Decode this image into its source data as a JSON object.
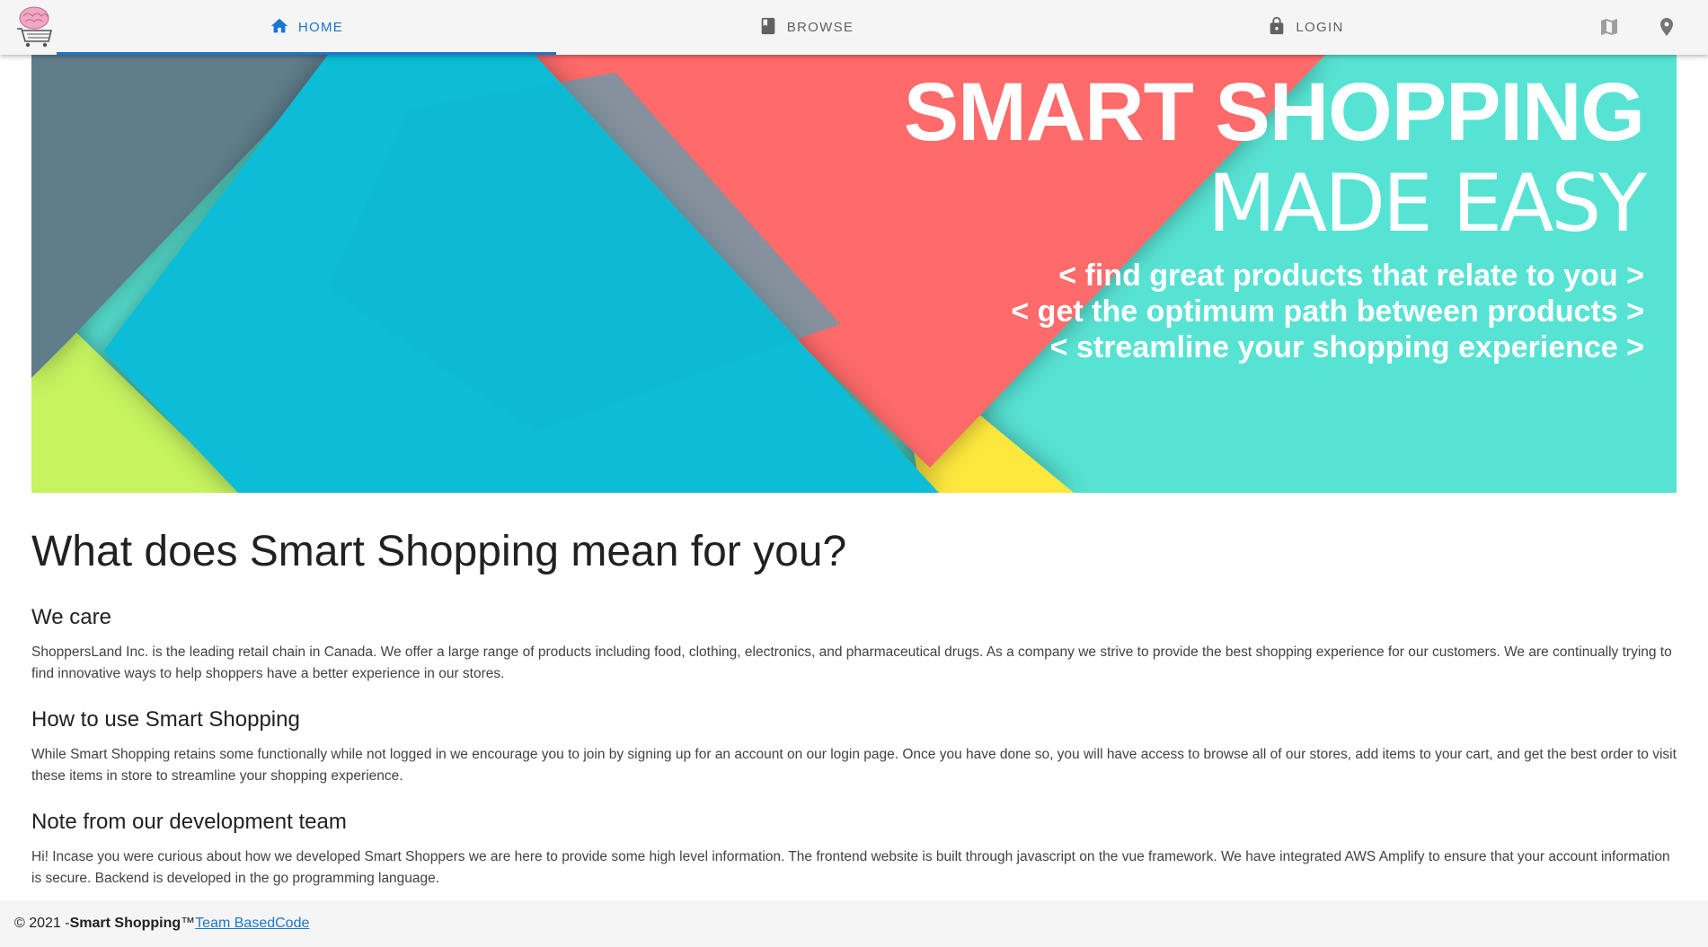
{
  "nav": {
    "tabs": [
      {
        "label": "HOME",
        "icon": "home-icon",
        "active": true
      },
      {
        "label": "BROWSE",
        "icon": "book-icon",
        "active": false
      },
      {
        "label": "LOGIN",
        "icon": "lock-icon",
        "active": false
      }
    ],
    "right_icons": [
      "map-icon",
      "map-marker-icon"
    ]
  },
  "hero": {
    "title": "SMART SHOPPING",
    "subtitle": "MADE EASY",
    "bullets": [
      "< find great products that relate to you >",
      "< get the optimum path between products >",
      "< streamline your shopping experience >"
    ]
  },
  "main": {
    "title": "What does Smart Shopping mean for you?",
    "sections": [
      {
        "heading": "We care",
        "body": "ShoppersLand Inc. is the leading retail chain in Canada. We offer a large range of products including food, clothing, electronics, and pharmaceutical drugs. As a company we strive to provide the best shopping experience for our customers. We are continually trying to find innovative ways to help shoppers have a better experience in our stores."
      },
      {
        "heading": "How to use Smart Shopping",
        "body": "While Smart Shopping retains some functionally while not logged in we encourage you to join by signing up for an account on our login page. Once you have done so, you will have access to browse all of our stores, add items to your cart, and get the best order to visit these items in store to streamline your shopping experience."
      },
      {
        "heading": "Note from our development team",
        "body": "Hi! Incase you were curious about how we developed Smart Shoppers we are here to provide some high level information. The frontend website is built through javascript on the vue framework. We have integrated AWS Amplify to ensure that your account information is secure. Backend is developed in the go programming language."
      }
    ]
  },
  "footer": {
    "copyright": "© 2021 -",
    "brand": "Smart Shopping",
    "trademark": "™",
    "team_link": "Team BasedCode"
  },
  "colors": {
    "accent": "#1976d2",
    "hero_teal": "#57e3d3",
    "hero_blue": "#0fbcd6",
    "hero_red": "#ff6b6b",
    "hero_slate": "#607d8b",
    "hero_lime": "#c6f35e",
    "hero_yellow": "#ffe83d"
  }
}
